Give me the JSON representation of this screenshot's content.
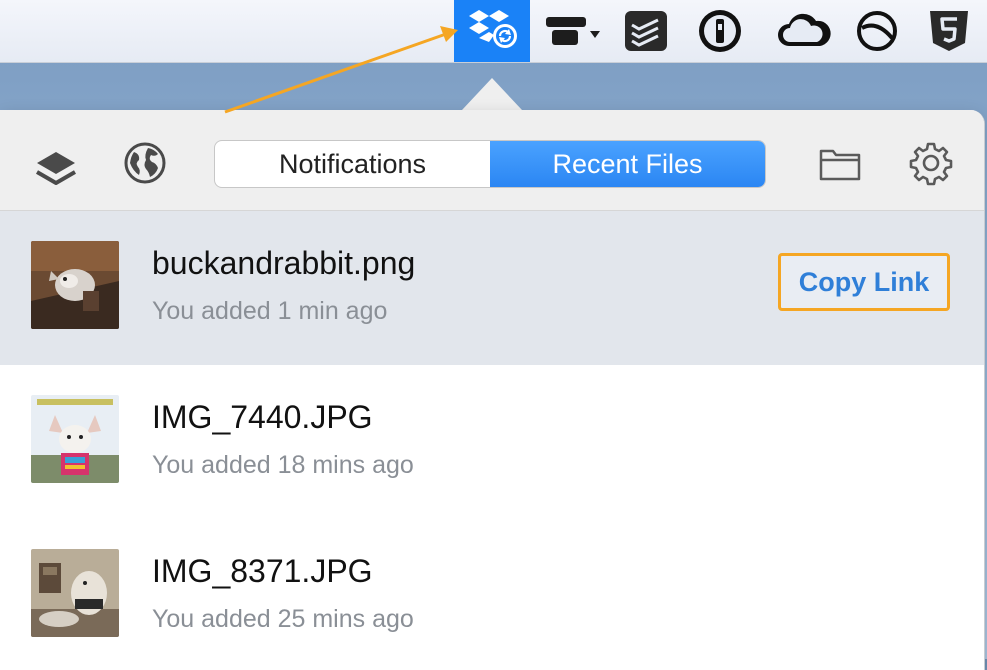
{
  "menubar": {
    "icons": [
      {
        "name": "dropbox-sync-icon",
        "active": true
      },
      {
        "name": "tower-icon"
      },
      {
        "name": "todoist-icon"
      },
      {
        "name": "1password-icon"
      },
      {
        "name": "cloud-icon"
      },
      {
        "name": "circle-icon"
      },
      {
        "name": "html5-shield-icon"
      }
    ],
    "active_color": "#1a82f7"
  },
  "popover": {
    "toolbar": {
      "left_icons": [
        "layers-icon",
        "globe-icon"
      ],
      "right_icons": [
        "folder-icon",
        "gear-icon"
      ],
      "tabs": [
        {
          "label": "Notifications",
          "active": false
        },
        {
          "label": "Recent Files",
          "active": true
        }
      ]
    },
    "files": [
      {
        "name": "buckandrabbit.png",
        "meta": "You added 1 min ago",
        "selected": true,
        "action_label": "Copy Link"
      },
      {
        "name": "IMG_7440.JPG",
        "meta": "You added 18 mins ago",
        "selected": false
      },
      {
        "name": "IMG_8371.JPG",
        "meta": "You added 25 mins ago",
        "selected": false
      }
    ]
  },
  "colors": {
    "accent": "#2b86f3",
    "highlight_outline": "#f5a623",
    "selected_row": "#e2e6ec"
  }
}
